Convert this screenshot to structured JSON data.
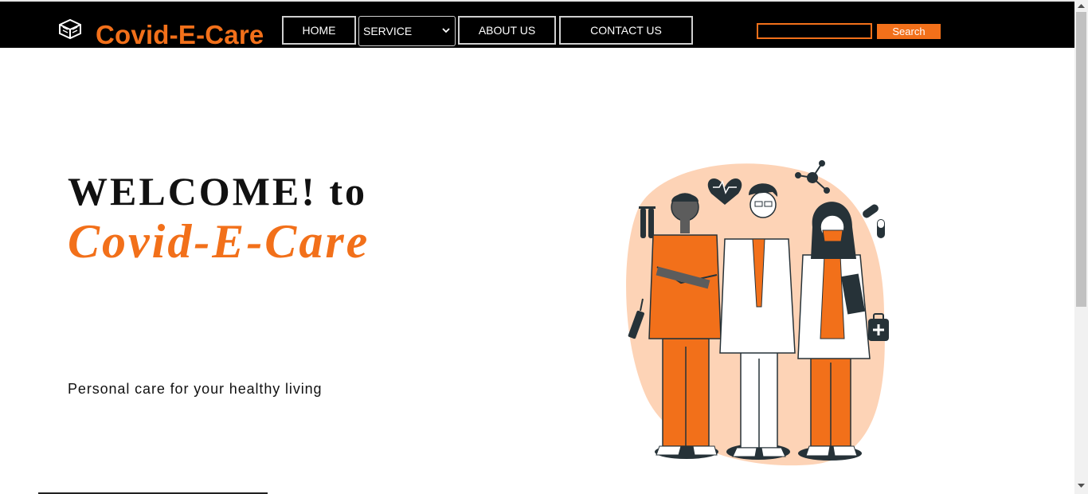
{
  "brand": {
    "name": "Covid-E-Care",
    "logo_icon": "box-icon"
  },
  "nav": {
    "home": "HOME",
    "service_selected": "SERVICE",
    "about": "ABOUT US",
    "contact": "CONTACT US"
  },
  "search": {
    "value": "",
    "button": "Search"
  },
  "hero": {
    "welcome": "WELCOME! to",
    "brand": "Covid-E-Care",
    "tagline": "Personal care for your healthy living",
    "illustration": "medical-staff-illustration"
  },
  "colors": {
    "accent": "#f2701a",
    "accent_light": "#fdd3b6",
    "nav_bg": "#000000"
  }
}
